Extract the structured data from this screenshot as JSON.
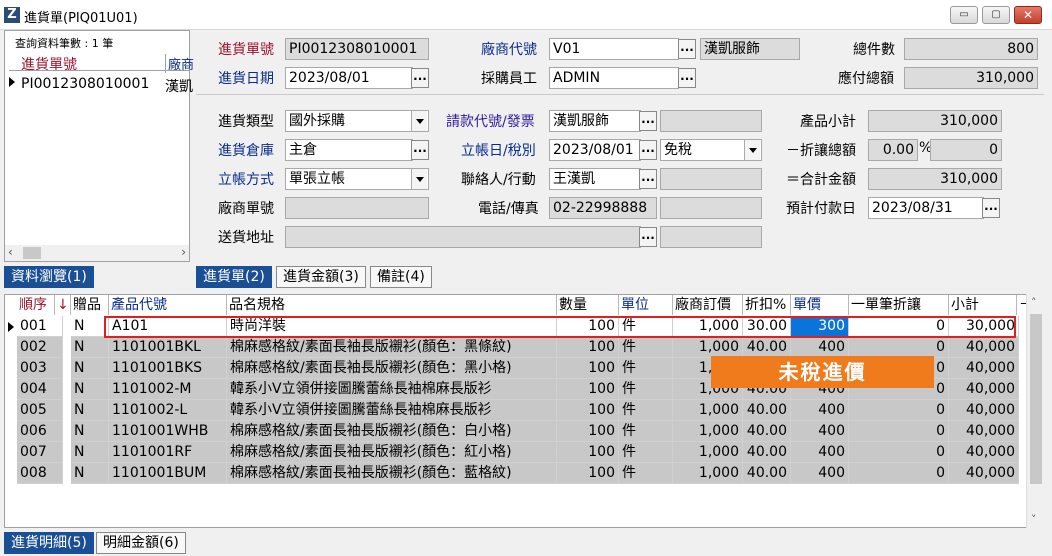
{
  "window": {
    "title": "進貨單(PIQ01U01)",
    "app_icon": "Z",
    "btn_min": "▭",
    "btn_max": "▢",
    "btn_close": "✕"
  },
  "browse": {
    "query_count": "查詢資料筆數 : 1 筆",
    "col1": "進貨單號",
    "col2": "廠商",
    "row_no": "PI0012308010001",
    "row_vendor": "漢凱"
  },
  "tabs_top": {
    "browse": "資料瀏覽(1)",
    "order": "進貨單(2)",
    "amount": "進貨金額(3)",
    "note": "備註(4)"
  },
  "tabs_bottom": {
    "detail": "進貨明細(5)",
    "detail_amount": "明細金額(6)"
  },
  "form": {
    "order_no_label": "進貨單號",
    "order_no": "PI0012308010001",
    "date_label": "進貨日期",
    "date": "2023/08/01",
    "vendor_code_label": "廠商代號",
    "vendor_code": "V01",
    "vendor_name": "漢凱服飾",
    "buyer_label": "採購員工",
    "buyer": "ADMIN",
    "total_qty_label": "總件數",
    "total_qty": "800",
    "payable_label": "應付總額",
    "payable": "310,000",
    "type_label": "進貨類型",
    "type": "國外採購",
    "billing_label": "請款代號/發票",
    "billing": "漢凱服飾",
    "invoice": "",
    "subtotal_label": "產品小計",
    "subtotal": "310,000",
    "warehouse_label": "進貨倉庫",
    "warehouse": "主倉",
    "account_date_label": "立帳日/稅別",
    "account_date": "2023/08/01",
    "tax": "免稅",
    "discount_label": "－折讓總額",
    "discount_pct": "0.00",
    "pct_sign": "%",
    "discount_amt": "0",
    "account_method_label": "立帳方式",
    "account_method": "單張立帳",
    "contact_label": "聯絡人/行動",
    "contact": "王漢凱",
    "mobile": "",
    "total_label": "＝合計金額",
    "total": "310,000",
    "vendor_order_label": "廠商單號",
    "vendor_order": "",
    "phone_label": "電話/傳真",
    "phone": "02-22998888",
    "fax": "",
    "pay_date_label": "預計付款日",
    "pay_date": "2023/08/31",
    "address_label": "送貨地址",
    "address": "",
    "address2": "",
    "dots": "..."
  },
  "grid": {
    "headers": [
      "順序",
      "↓",
      "贈品",
      "產品代號",
      "品名規格",
      "數量",
      "單位",
      "廠商訂價",
      "折扣%",
      "單價",
      "一單筆折讓",
      "小計",
      "－"
    ],
    "rows": [
      [
        "001",
        "N",
        "A101",
        "時尚洋裝",
        "100",
        "件",
        "1,000",
        "30.00",
        "300",
        "0",
        "30,000"
      ],
      [
        "002",
        "N",
        "1101001BKL",
        "棉麻感格紋/素面長袖長版襯衫(顏色：黑條紋)",
        "100",
        "件",
        "1,000",
        "40.00",
        "400",
        "0",
        "40,000"
      ],
      [
        "003",
        "N",
        "1101001BKS",
        "棉麻感格紋/素面長袖長版襯衫(顏色：黑小格)",
        "100",
        "件",
        "1,000",
        "40.00",
        "400",
        "0",
        "40,000"
      ],
      [
        "004",
        "N",
        "1101002-M",
        "韓系小V立領併接圖騰蕾絲長袖棉麻長版衫",
        "100",
        "件",
        "1,000",
        "40.00",
        "400",
        "0",
        "40,000"
      ],
      [
        "005",
        "N",
        "1101002-L",
        "韓系小V立領併接圖騰蕾絲長袖棉麻長版衫",
        "100",
        "件",
        "1,000",
        "40.00",
        "400",
        "0",
        "40,000"
      ],
      [
        "006",
        "N",
        "1101001WHB",
        "棉麻感格紋/素面長袖長版襯衫(顏色：白小格)",
        "100",
        "件",
        "1,000",
        "40.00",
        "400",
        "0",
        "40,000"
      ],
      [
        "007",
        "N",
        "1101001RF",
        "棉麻感格紋/素面長袖長版襯衫(顏色：紅小格)",
        "100",
        "件",
        "1,000",
        "40.00",
        "400",
        "0",
        "40,000"
      ],
      [
        "008",
        "N",
        "1101001BUM",
        "棉麻感格紋/素面長袖長版襯衫(顏色：藍格紋)",
        "100",
        "件",
        "1,000",
        "40.00",
        "400",
        "0",
        "40,000"
      ]
    ]
  },
  "annotation": {
    "callout": "未稅進價"
  },
  "colors": {
    "accent": "#1b4f95",
    "highlight": "#e0201e",
    "callout": "#ef7b1c"
  }
}
